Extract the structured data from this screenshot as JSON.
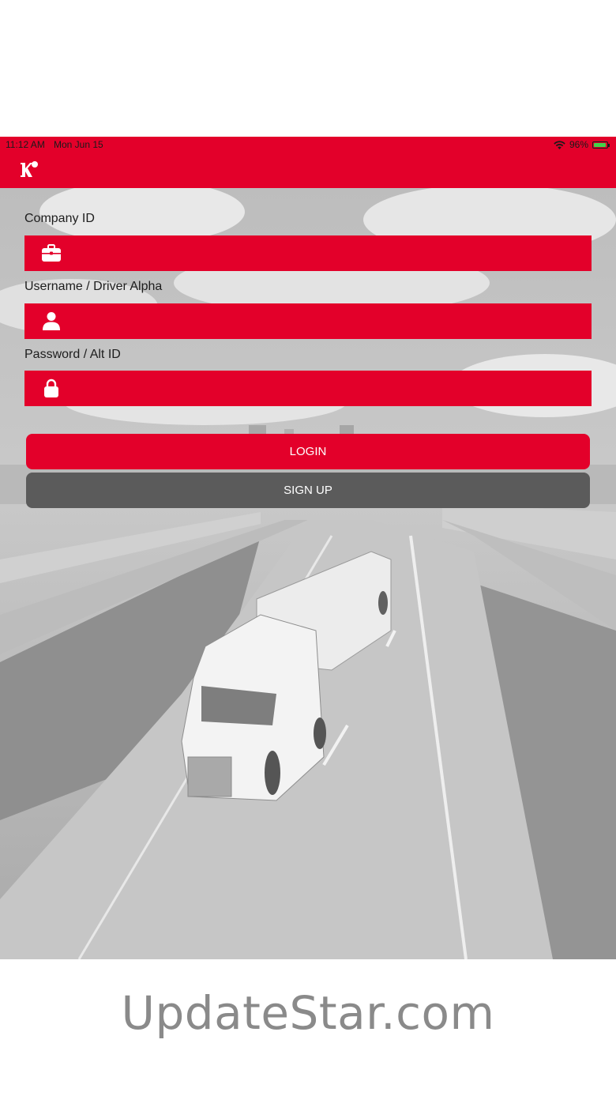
{
  "status_bar": {
    "time": "11:12 AM",
    "date": "Mon Jun 15",
    "battery_text": "96%",
    "battery_level": 0.96
  },
  "nav": {
    "logo_icon": "k-logo-icon"
  },
  "form": {
    "company_id": {
      "label": "Company ID",
      "value": "",
      "icon": "briefcase-icon"
    },
    "username": {
      "label": "Username / Driver Alpha",
      "value": "",
      "icon": "person-icon"
    },
    "password": {
      "label": "Password / Alt ID",
      "value": "",
      "icon": "lock-icon"
    }
  },
  "buttons": {
    "login_label": "LOGIN",
    "signup_label": "SIGN UP"
  },
  "watermark": "UpdateStar.com",
  "colors": {
    "primary": "#e3002a",
    "secondary_button": "#5b5b5b",
    "label_text": "#1d1d1d",
    "button_text": "#ffffff"
  }
}
